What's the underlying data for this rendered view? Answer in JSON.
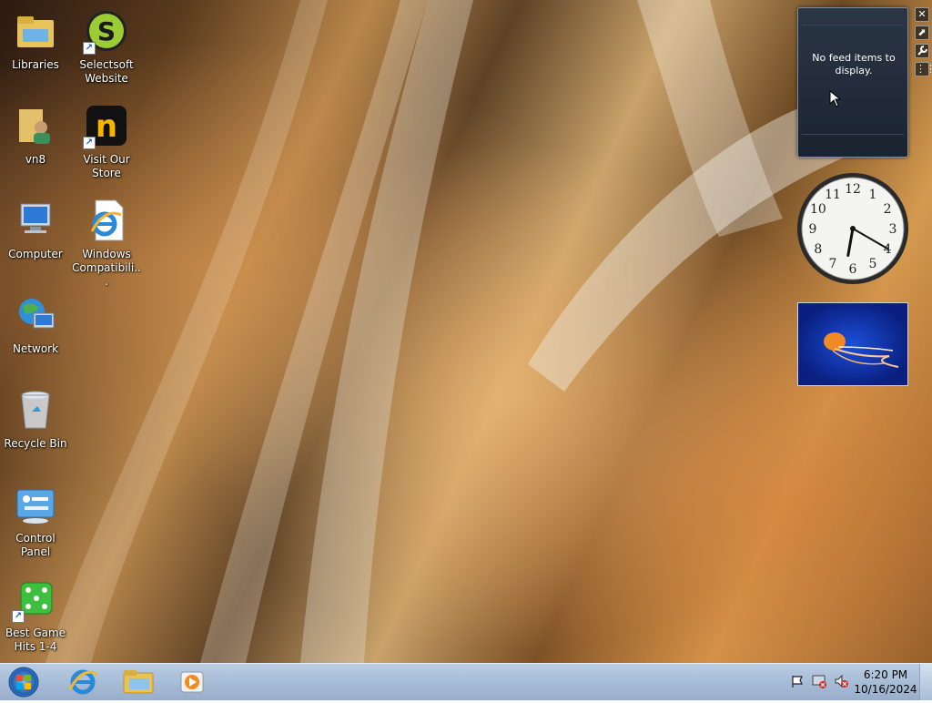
{
  "desktop": {
    "icons": [
      {
        "label": "Libraries"
      },
      {
        "label": "Selectsoft Website"
      },
      {
        "label": "vn8"
      },
      {
        "label": "Visit Our Store"
      },
      {
        "label": "Computer"
      },
      {
        "label": "Windows Compatibili..."
      },
      {
        "label": "Network"
      },
      {
        "label": "Recycle Bin"
      },
      {
        "label": "Control Panel"
      },
      {
        "label": "Best Game Hits 1-4"
      }
    ]
  },
  "gadgets": {
    "feed": {
      "message": "No feed items to display."
    },
    "clock": {
      "hour": 6,
      "minute": 20,
      "numerals": [
        "12",
        "1",
        "2",
        "3",
        "4",
        "5",
        "6",
        "7",
        "8",
        "9",
        "10",
        "11"
      ]
    },
    "controls": {
      "close": "✕",
      "size": "⬈",
      "options": "🔧",
      "drag": "⋮⋮"
    }
  },
  "taskbar": {
    "time": "6:20 PM",
    "date": "10/16/2024",
    "pinned": [
      "internet-explorer-icon",
      "windows-explorer-icon",
      "media-player-icon"
    ]
  },
  "colors": {
    "taskbar": "#a7bcd6",
    "gadget_bg": "#1b2331"
  }
}
